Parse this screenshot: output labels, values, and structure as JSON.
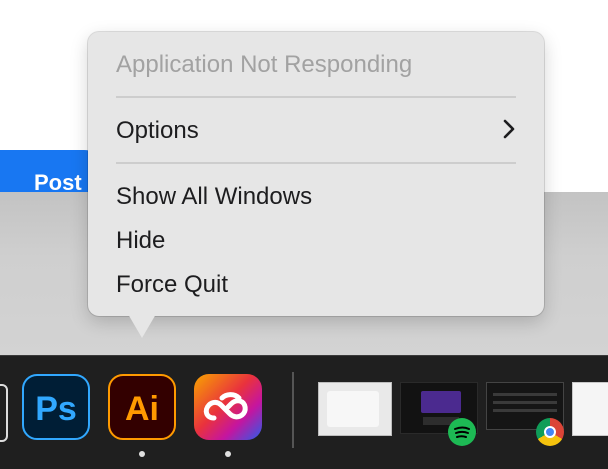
{
  "background": {
    "post_button_label": "Post"
  },
  "context_menu": {
    "header": "Application Not Responding",
    "items": [
      {
        "label": "Options",
        "has_submenu": true
      },
      {
        "label": "Show All Windows"
      },
      {
        "label": "Hide"
      },
      {
        "label": "Force Quit"
      }
    ]
  },
  "dock": {
    "apps": [
      {
        "name": "Photoshop",
        "glyph": "Ps",
        "running": false
      },
      {
        "name": "Illustrator",
        "glyph": "Ai",
        "running": true
      },
      {
        "name": "Creative Cloud",
        "icon": "creative-cloud-icon",
        "running": true
      }
    ],
    "window_thumbnails": [
      {
        "app": "Illustrator",
        "icon": "document-window-icon"
      },
      {
        "app": "Spotify",
        "icon": "spotify-icon"
      },
      {
        "app": "Chrome",
        "icon": "chrome-icon"
      },
      {
        "app": "Document",
        "icon": "document-window-icon"
      }
    ]
  },
  "colors": {
    "post_button": "#1877f2",
    "menu_bg": "#e6e6e6",
    "dock_bg": "#1f1f1f",
    "ps_accent": "#31a8ff",
    "ai_accent": "#ff9a00"
  }
}
